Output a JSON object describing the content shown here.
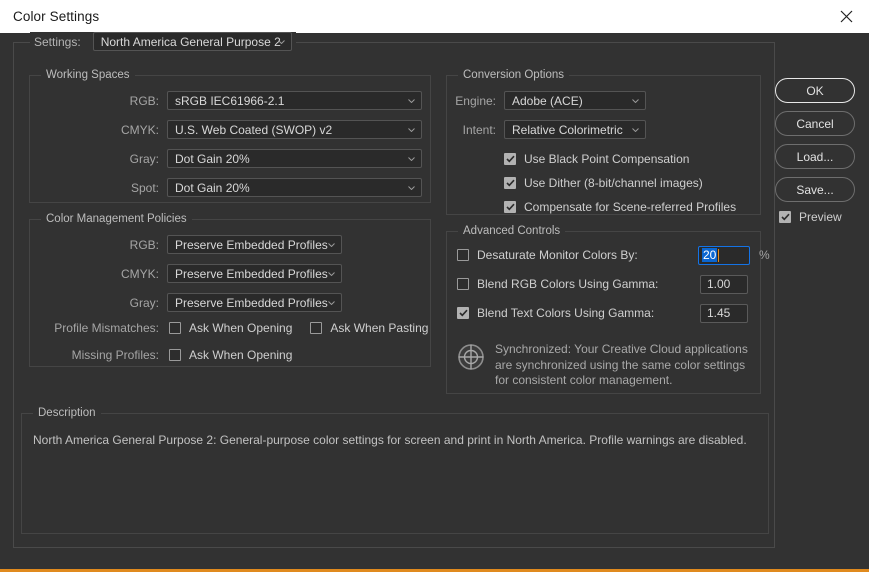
{
  "window": {
    "title": "Color Settings",
    "close_icon": "close-icon",
    "accent_color": "#e08a1e",
    "background_color": "#323232",
    "titlebar_color": "#ffffff"
  },
  "settings": {
    "label": "Settings:",
    "value": "North America General Purpose 2"
  },
  "working_spaces": {
    "legend": "Working Spaces",
    "rows": [
      {
        "label": "RGB:",
        "value": "sRGB IEC61966-2.1"
      },
      {
        "label": "CMYK:",
        "value": "U.S. Web Coated (SWOP) v2"
      },
      {
        "label": "Gray:",
        "value": "Dot Gain 20%"
      },
      {
        "label": "Spot:",
        "value": "Dot Gain 20%"
      }
    ]
  },
  "color_management_policies": {
    "legend": "Color Management Policies",
    "rows": [
      {
        "label": "RGB:",
        "value": "Preserve Embedded Profiles"
      },
      {
        "label": "CMYK:",
        "value": "Preserve Embedded Profiles"
      },
      {
        "label": "Gray:",
        "value": "Preserve Embedded Profiles"
      }
    ],
    "profile_mismatches_label": "Profile Mismatches:",
    "ask_when_opening_mismatch": {
      "label": "Ask When Opening",
      "checked": false
    },
    "ask_when_pasting": {
      "label": "Ask When Pasting",
      "checked": false
    },
    "missing_profiles_label": "Missing Profiles:",
    "ask_when_opening_missing": {
      "label": "Ask When Opening",
      "checked": false
    }
  },
  "conversion_options": {
    "legend": "Conversion Options",
    "engine_label": "Engine:",
    "engine_value": "Adobe (ACE)",
    "intent_label": "Intent:",
    "intent_value": "Relative Colorimetric",
    "black_point": {
      "label": "Use Black Point Compensation",
      "checked": true
    },
    "dither": {
      "label": "Use Dither (8-bit/channel images)",
      "checked": true
    },
    "scene_referred": {
      "label": "Compensate for Scene-referred Profiles",
      "checked": true
    }
  },
  "advanced_controls": {
    "legend": "Advanced Controls",
    "desaturate": {
      "label": "Desaturate Monitor Colors By:",
      "checked": false,
      "value": "20",
      "unit": "%",
      "focused": true
    },
    "blend_rgb": {
      "label": "Blend RGB Colors Using Gamma:",
      "checked": false,
      "value": "1.00"
    },
    "blend_text": {
      "label": "Blend Text Colors Using Gamma:",
      "checked": true,
      "value": "1.45"
    }
  },
  "sync_note": {
    "icon": "sync-globe-icon",
    "text": "Synchronized: Your Creative Cloud applications are synchronized using the same color settings for consistent color management."
  },
  "description": {
    "legend": "Description",
    "text": "North America General Purpose 2:  General-purpose color settings for screen and print in North America. Profile warnings are disabled."
  },
  "buttons": {
    "ok": "OK",
    "cancel": "Cancel",
    "load": "Load...",
    "save": "Save...",
    "preview": {
      "label": "Preview",
      "checked": true
    }
  }
}
